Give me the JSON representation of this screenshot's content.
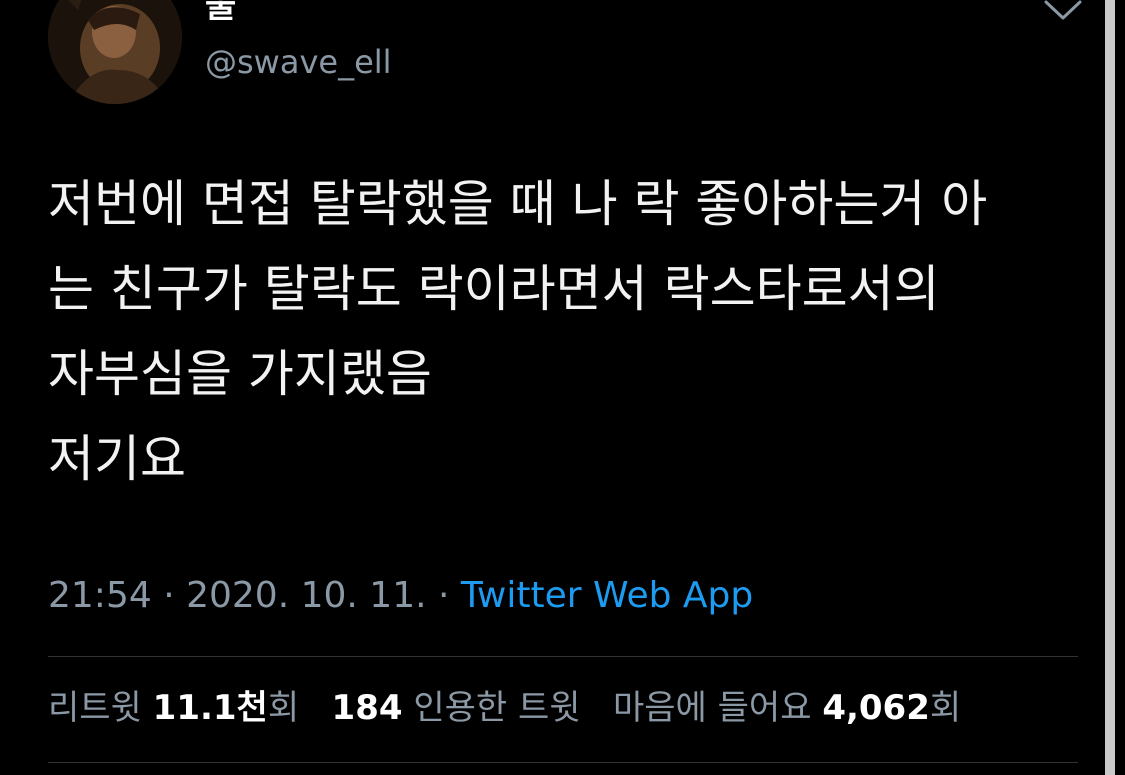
{
  "user": {
    "display_name": "울",
    "handle": "@swave_ell"
  },
  "tweet": {
    "lines": [
      "저번에 면접 탈락했을 때 나 락 좋아하는거 아",
      "는 친구가 탈락도 락이라면서 락스타로서의",
      "자부심을 가지랬음",
      "저기요"
    ]
  },
  "meta": {
    "time": "21:54",
    "sep1": " · ",
    "date": "2020. 10. 11.",
    "sep2": " · ",
    "source": "Twitter Web App"
  },
  "stats": {
    "retweets_label": "리트윗",
    "retweets_count": "11.1천",
    "retweets_suffix": "회",
    "quotes_count": "184",
    "quotes_label": "인용한 트윗",
    "likes_label": "마음에 들어요",
    "likes_count": "4,062",
    "likes_suffix": "회"
  },
  "icons": {
    "menu": "chevron-down-icon"
  },
  "colors": {
    "background": "#000000",
    "text": "#f2f2f2",
    "muted": "#8b98a5",
    "link": "#1d9bf0",
    "divider": "#2f3336"
  }
}
